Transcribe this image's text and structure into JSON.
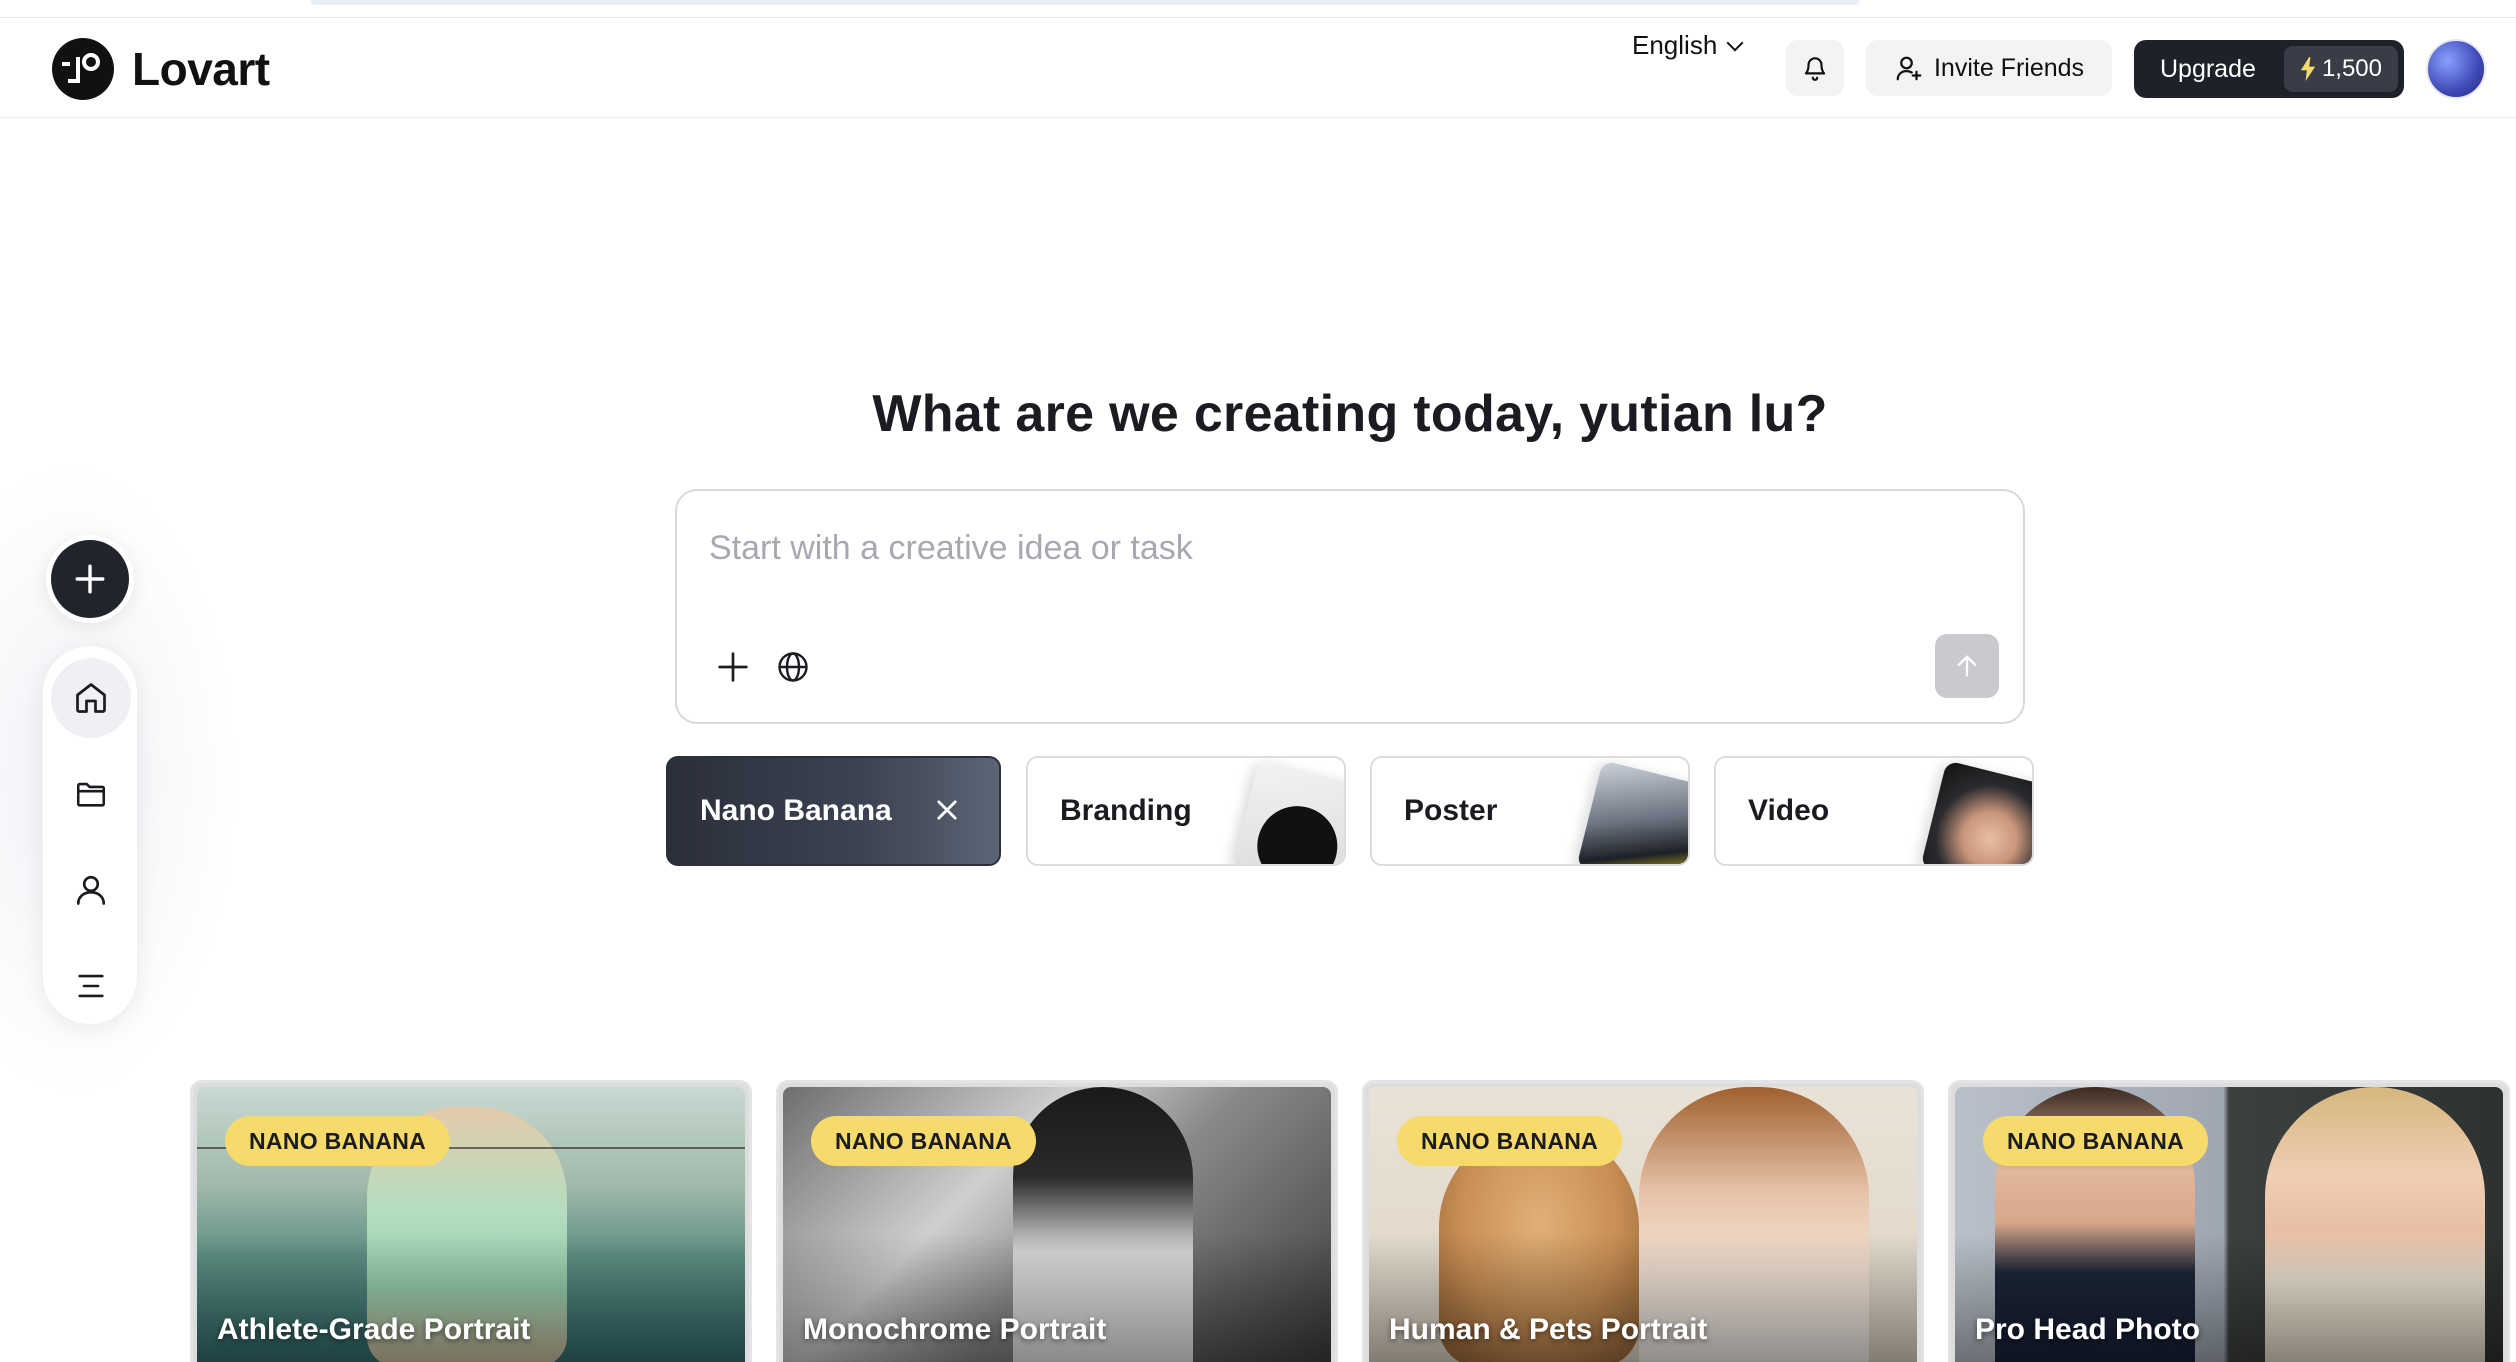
{
  "brand": {
    "name": "Lovart"
  },
  "header": {
    "language": "English",
    "notifications_icon": "bell-icon",
    "invite_label": "Invite Friends",
    "upgrade_label": "Upgrade",
    "credits": "1,500"
  },
  "sidebar": {
    "new_icon": "plus-icon",
    "items": [
      {
        "name": "home",
        "icon": "home-icon"
      },
      {
        "name": "projects",
        "icon": "folder-icon"
      },
      {
        "name": "profile",
        "icon": "user-icon"
      },
      {
        "name": "menu",
        "icon": "menu-icon"
      }
    ]
  },
  "main": {
    "headline": "What are we creating today,  yutian lu?",
    "prompt_placeholder": "Start with a creative idea or task",
    "prompt_value": ""
  },
  "chips": [
    {
      "label": "Nano Banana",
      "active": true
    },
    {
      "label": "Branding",
      "active": false
    },
    {
      "label": "Poster",
      "active": false
    },
    {
      "label": "Video",
      "active": false
    }
  ],
  "cards": [
    {
      "badge": "NANO BANANA",
      "title": "Athlete-Grade Portrait"
    },
    {
      "badge": "NANO BANANA",
      "title": "Monochrome Portrait"
    },
    {
      "badge": "NANO BANANA",
      "title": "Human & Pets Portrait"
    },
    {
      "badge": "NANO BANANA",
      "title": "Pro Head Photo"
    }
  ],
  "colors": {
    "primary_dark": "#1d2129",
    "badge_yellow": "#f6da6b",
    "border": "#d7d9de"
  }
}
